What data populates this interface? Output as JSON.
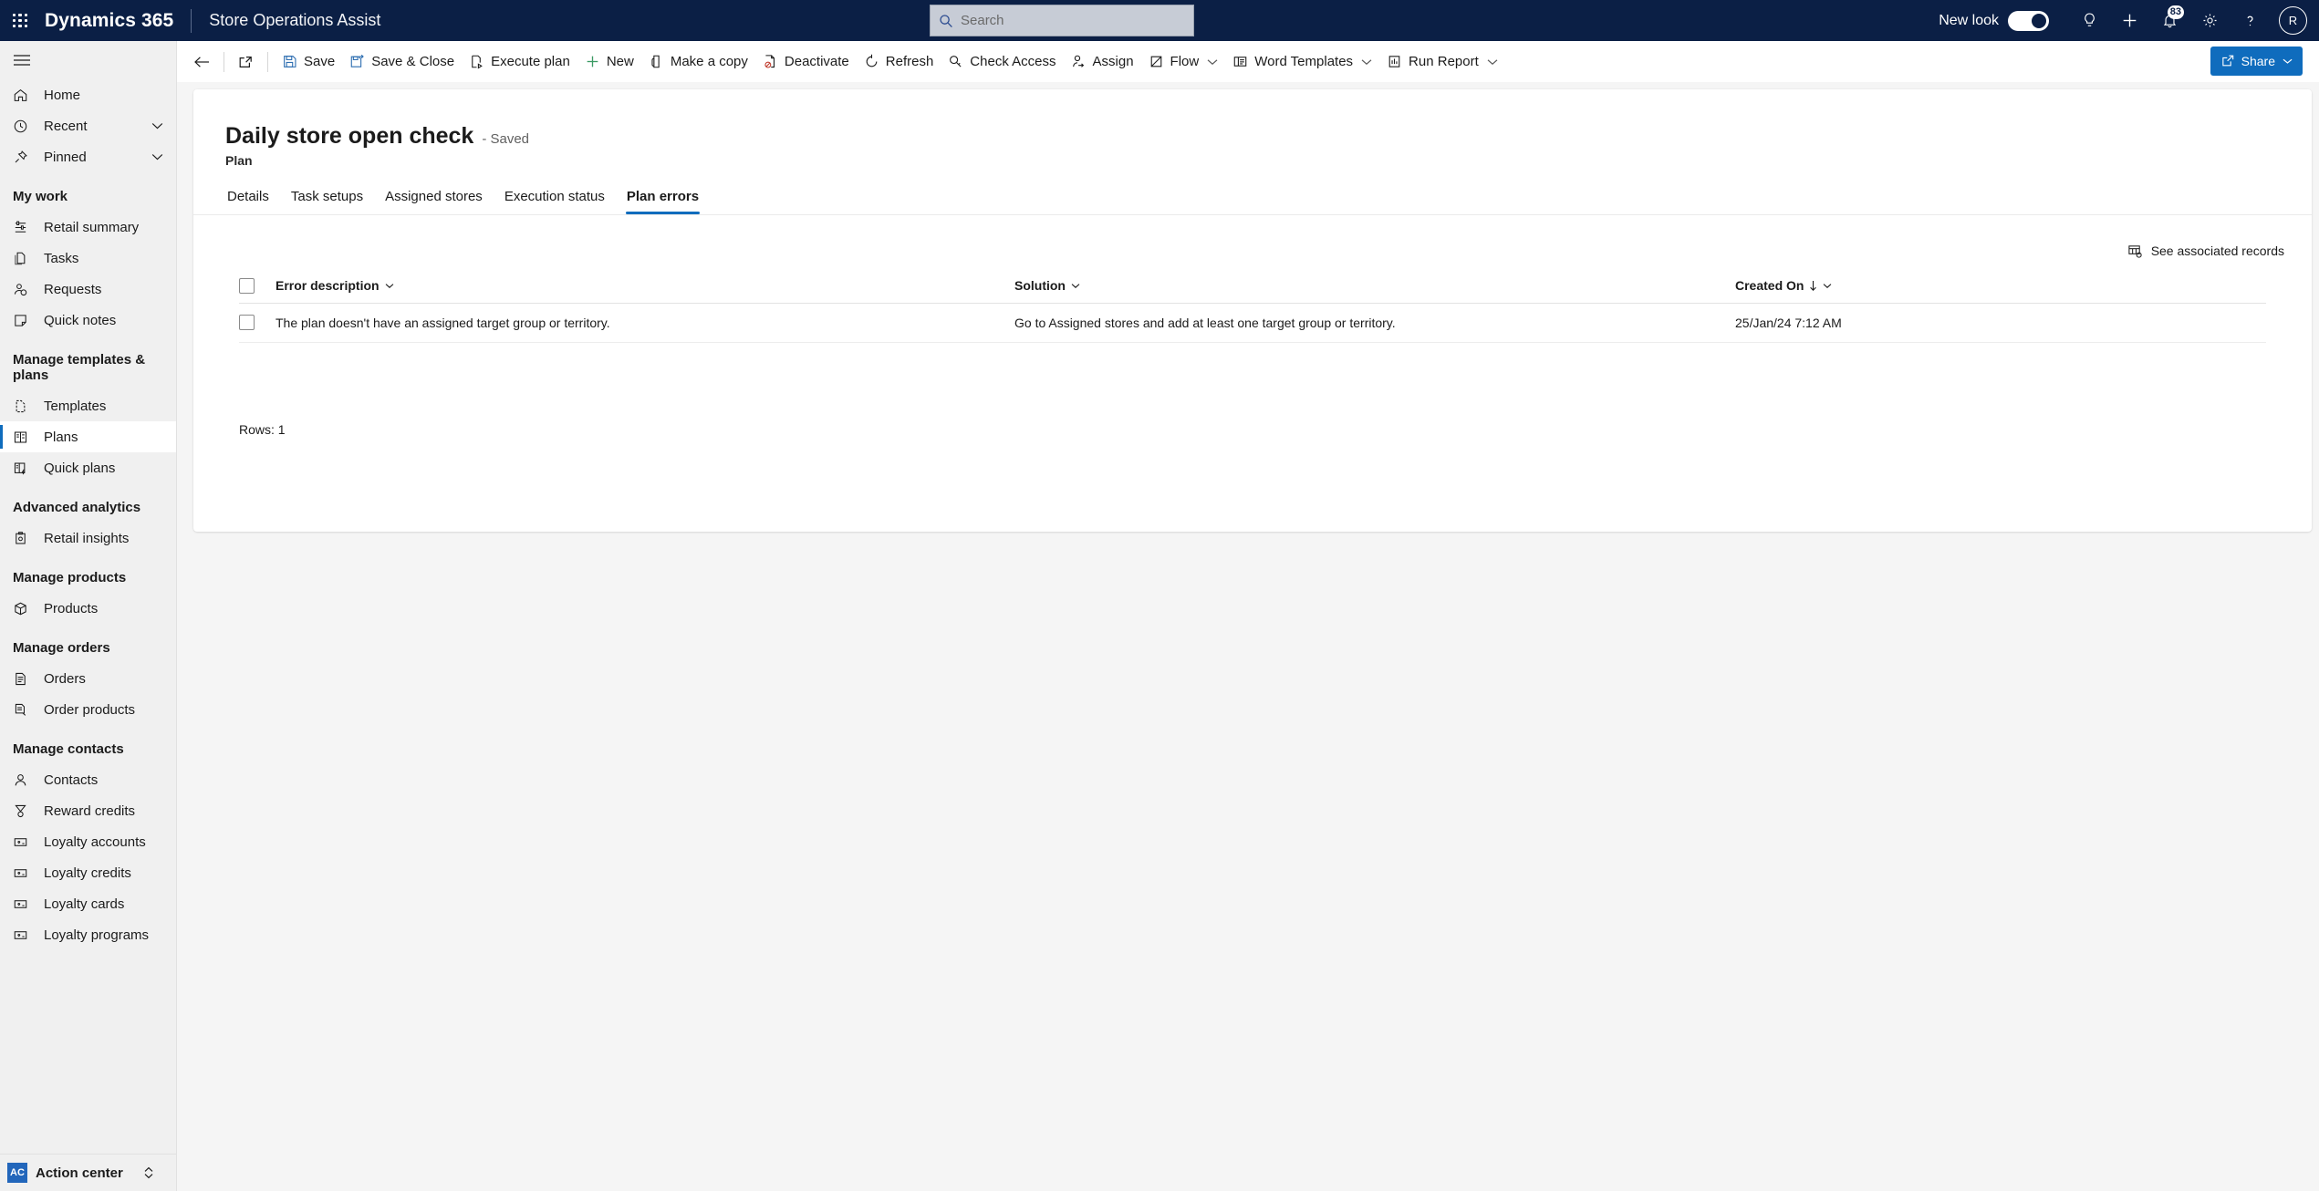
{
  "topnav": {
    "waffle_icon": "app-launcher-icon",
    "brand": "Dynamics 365",
    "app_name": "Store Operations Assist",
    "search": {
      "placeholder": "Search",
      "value": "",
      "icon": "search-icon"
    },
    "new_look_label": "New look",
    "new_look_on": true,
    "icons": [
      {
        "name": "lightbulb-icon",
        "glyph": "bulb"
      },
      {
        "name": "add-icon",
        "glyph": "plus"
      },
      {
        "name": "notifications-icon",
        "glyph": "bell",
        "badge": "83"
      },
      {
        "name": "settings-gear-icon",
        "glyph": "gear"
      },
      {
        "name": "help-icon",
        "glyph": "question"
      }
    ],
    "avatar_initials": "R"
  },
  "sidebar": {
    "hamburger_icon": "hamburger-menu-icon",
    "top_items": [
      {
        "label": "Home",
        "icon": "home-icon",
        "chevron": false,
        "active": false
      },
      {
        "label": "Recent",
        "icon": "clock-icon",
        "chevron": true,
        "active": false
      },
      {
        "label": "Pinned",
        "icon": "pin-icon",
        "chevron": true,
        "active": false
      }
    ],
    "groups": [
      {
        "title": "My work",
        "items": [
          {
            "label": "Retail summary",
            "icon": "retail-summary-icon",
            "active": false
          },
          {
            "label": "Tasks",
            "icon": "tasks-icon",
            "active": false
          },
          {
            "label": "Requests",
            "icon": "requests-icon",
            "active": false
          },
          {
            "label": "Quick notes",
            "icon": "quick-notes-icon",
            "active": false
          }
        ]
      },
      {
        "title": "Manage templates & plans",
        "items": [
          {
            "label": "Templates",
            "icon": "templates-icon",
            "active": false
          },
          {
            "label": "Plans",
            "icon": "plans-icon",
            "active": true
          },
          {
            "label": "Quick plans",
            "icon": "quick-plans-icon",
            "active": false
          }
        ]
      },
      {
        "title": "Advanced analytics",
        "items": [
          {
            "label": "Retail insights",
            "icon": "retail-insights-icon",
            "active": false
          }
        ]
      },
      {
        "title": "Manage products",
        "items": [
          {
            "label": "Products",
            "icon": "products-box-icon",
            "active": false
          }
        ]
      },
      {
        "title": "Manage orders",
        "items": [
          {
            "label": "Orders",
            "icon": "orders-doc-icon",
            "active": false
          },
          {
            "label": "Order products",
            "icon": "order-products-icon",
            "active": false
          }
        ]
      },
      {
        "title": "Manage contacts",
        "items": [
          {
            "label": "Contacts",
            "icon": "contact-person-icon",
            "active": false
          },
          {
            "label": "Reward credits",
            "icon": "reward-medal-icon",
            "active": false
          },
          {
            "label": "Loyalty accounts",
            "icon": "loyalty-card-icon",
            "active": false
          },
          {
            "label": "Loyalty credits",
            "icon": "loyalty-card-icon",
            "active": false
          },
          {
            "label": "Loyalty cards",
            "icon": "loyalty-card-icon",
            "active": false
          },
          {
            "label": "Loyalty programs",
            "icon": "loyalty-card-icon",
            "active": false
          }
        ]
      }
    ],
    "action_center": {
      "badge": "AC",
      "label": "Action center",
      "chevron_icon": "expand-collapse-icon"
    }
  },
  "command_bar": {
    "back_icon": "back-arrow-icon",
    "popout_icon": "open-in-new-window-icon",
    "buttons": [
      {
        "label": "Save",
        "icon": "save-disk-icon",
        "chevron": false
      },
      {
        "label": "Save & Close",
        "icon": "save-and-close-icon",
        "chevron": false
      },
      {
        "label": "Execute plan",
        "icon": "execute-plan-icon",
        "chevron": false
      },
      {
        "label": "New",
        "icon": "plus-icon",
        "chevron": false
      },
      {
        "label": "Make a copy",
        "icon": "copy-icon",
        "chevron": false
      },
      {
        "label": "Deactivate",
        "icon": "deactivate-icon",
        "chevron": false
      },
      {
        "label": "Refresh",
        "icon": "refresh-icon",
        "chevron": false
      },
      {
        "label": "Check Access",
        "icon": "check-access-key-icon",
        "chevron": false
      },
      {
        "label": "Assign",
        "icon": "assign-person-icon",
        "chevron": false
      },
      {
        "label": "Flow",
        "icon": "flow-icon",
        "chevron": true
      },
      {
        "label": "Word Templates",
        "icon": "word-templates-icon",
        "chevron": true
      },
      {
        "label": "Run Report",
        "icon": "run-report-icon",
        "chevron": true
      }
    ],
    "share": {
      "label": "Share",
      "icon": "share-icon",
      "chevron": true
    }
  },
  "record": {
    "title": "Daily store open check",
    "saved_status": "- Saved",
    "entity": "Plan"
  },
  "tabs": [
    {
      "label": "Details",
      "active": false
    },
    {
      "label": "Task setups",
      "active": false
    },
    {
      "label": "Assigned stores",
      "active": false
    },
    {
      "label": "Execution status",
      "active": false
    },
    {
      "label": "Plan errors",
      "active": true
    }
  ],
  "grid": {
    "toolbar": {
      "see_associated_label": "See associated records",
      "see_associated_icon": "associated-records-icon"
    },
    "columns": [
      {
        "label": "Error description",
        "sort": "none"
      },
      {
        "label": "Solution",
        "sort": "none"
      },
      {
        "label": "Created On",
        "sort": "desc"
      }
    ],
    "rows": [
      {
        "error_description": "The plan doesn't have an assigned target group or territory.",
        "solution": "Go to Assigned stores and add at least one target group or territory.",
        "created_on": "25/Jan/24 7:12 AM",
        "selected": false
      }
    ],
    "rows_count_label": "Rows: 1"
  },
  "colors": {
    "nav_background": "#0b1f45",
    "accent": "#0f6cbd",
    "sidebar_background": "#f0f0f0",
    "page_background": "#f5f5f5",
    "badge_blue": "#2266bb"
  }
}
